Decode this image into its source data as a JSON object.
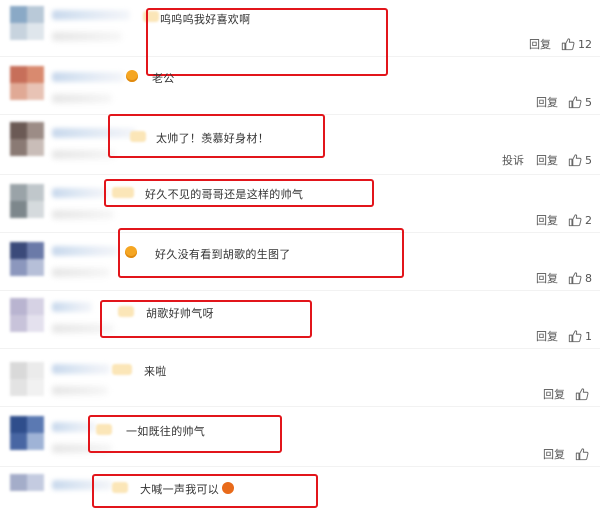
{
  "ui": {
    "reply_label": "回复",
    "report_label": "投诉",
    "highlight_color": "#e2151b"
  },
  "comments": [
    {
      "text": "呜呜呜我好喜欢啊",
      "likes": "12"
    },
    {
      "text": "老公",
      "likes": "5"
    },
    {
      "text": "太帅了！羡慕好身材！",
      "likes": "5"
    },
    {
      "text": "好久不见的哥哥还是这样的帅气",
      "likes": "2"
    },
    {
      "text": "好久没有看到胡歌的生图了",
      "likes": "8"
    },
    {
      "text": "胡歌好帅气呀",
      "likes": "1"
    },
    {
      "text": "来啦",
      "likes": ""
    },
    {
      "text": "一如既往的帅气",
      "likes": ""
    },
    {
      "text": "大喊一声我可以",
      "likes": ""
    }
  ]
}
